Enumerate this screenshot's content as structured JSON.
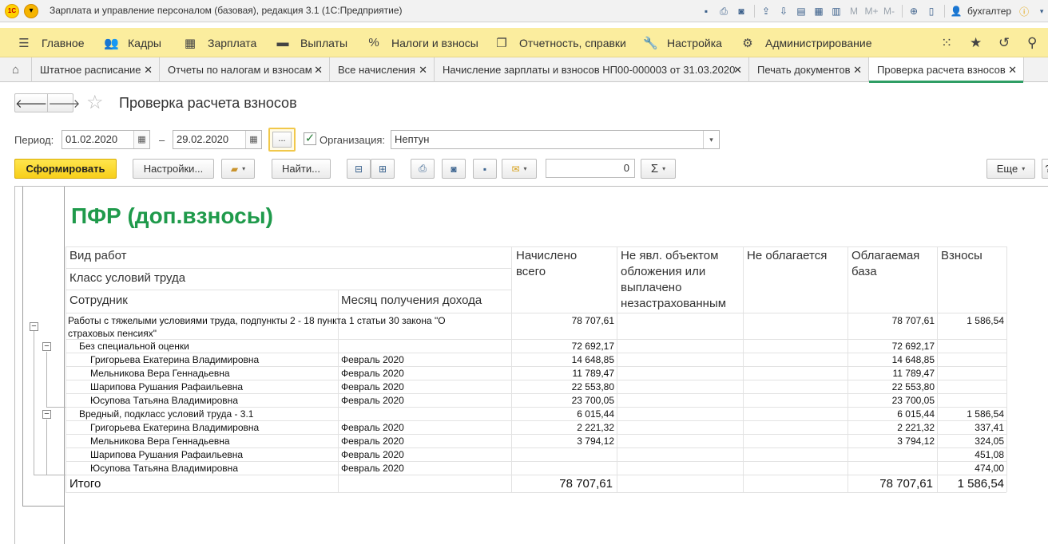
{
  "window": {
    "logo_text": "1С",
    "title": "Зарплата и управление персоналом (базовая), редакция 3.1  (1С:Предприятие)",
    "user": "бухгалтер",
    "zoom_icons": [
      "M",
      "M+",
      "M-"
    ]
  },
  "main_menu": [
    {
      "label": "Главное",
      "icon": "hamburger-icon"
    },
    {
      "label": "Кадры",
      "icon": "people-icon"
    },
    {
      "label": "Зарплата",
      "icon": "calculator-icon"
    },
    {
      "label": "Выплаты",
      "icon": "wallet-icon"
    },
    {
      "label": "Налоги и взносы",
      "icon": "percent-icon"
    },
    {
      "label": "Отчетность, справки",
      "icon": "documents-icon"
    },
    {
      "label": "Настройка",
      "icon": "wrench-icon"
    },
    {
      "label": "Администрирование",
      "icon": "gear-icon"
    }
  ],
  "tabs": [
    {
      "label": "Штатное расписание"
    },
    {
      "label": "Отчеты по налогам и взносам"
    },
    {
      "label": "Все начисления"
    },
    {
      "label": "Начисление зарплаты и взносов НП00-000003 от 31.03.2020"
    },
    {
      "label": "Печать документов"
    },
    {
      "label": "Проверка расчета взносов",
      "active": true
    }
  ],
  "form": {
    "title": "Проверка расчета взносов",
    "period_label": "Период:",
    "date_from": "01.02.2020",
    "dash": "–",
    "date_to": "29.02.2020",
    "dots": "...",
    "org_label": "Организация:",
    "org_value": "Нептун",
    "org_checked": true
  },
  "toolbar": {
    "generate": "Сформировать",
    "settings": "Настройки...",
    "find": "Найти...",
    "sum_value": "0",
    "sum_symbol": "Σ",
    "more": "Еще"
  },
  "report": {
    "title": "ПФР (доп.взносы)",
    "headers": {
      "work_type": "Вид работ",
      "conditions_class": "Класс условий труда",
      "employee": "Сотрудник",
      "income_month": "Месяц получения дохода",
      "accrued": "Начислено всего",
      "not_object": "Не явл. объектом обложения или выплачено незастрахованным",
      "not_taxed": "Не облагается",
      "tax_base": "Облагаемая база",
      "contributions": "Взносы"
    },
    "groups": [
      {
        "work_type": "Работы с тяжелыми условиями труда, подпункты 2 - 18 пункта 1 статьи 30 закона \"О страховых пенсиях\"",
        "accrued": "78 707,61",
        "tax_base": "78 707,61",
        "contributions": "1 586,54",
        "classes": [
          {
            "name": "Без специальной оценки",
            "accrued": "72 692,17",
            "tax_base": "72 692,17",
            "contributions": "",
            "rows": [
              {
                "employee": "Григорьева Екатерина Владимировна",
                "month": "Февраль 2020",
                "accrued": "14 648,85",
                "tax_base": "14 648,85",
                "contributions": ""
              },
              {
                "employee": "Мельникова Вера Геннадьевна",
                "month": "Февраль 2020",
                "accrued": "11 789,47",
                "tax_base": "11 789,47",
                "contributions": ""
              },
              {
                "employee": "Шарипова Рушания Рафаильевна",
                "month": "Февраль 2020",
                "accrued": "22 553,80",
                "tax_base": "22 553,80",
                "contributions": ""
              },
              {
                "employee": "Юсупова Татьяна Владимировна",
                "month": "Февраль 2020",
                "accrued": "23 700,05",
                "tax_base": "23 700,05",
                "contributions": ""
              }
            ]
          },
          {
            "name": "Вредный, подкласс условий труда - 3.1",
            "accrued": "6 015,44",
            "tax_base": "6 015,44",
            "contributions": "1 586,54",
            "rows": [
              {
                "employee": "Григорьева Екатерина Владимировна",
                "month": "Февраль 2020",
                "accrued": "2 221,32",
                "tax_base": "2 221,32",
                "contributions": "337,41"
              },
              {
                "employee": "Мельникова Вера Геннадьевна",
                "month": "Февраль 2020",
                "accrued": "3 794,12",
                "tax_base": "3 794,12",
                "contributions": "324,05"
              },
              {
                "employee": "Шарипова Рушания Рафаильевна",
                "month": "Февраль 2020",
                "accrued": "",
                "tax_base": "",
                "contributions": "451,08"
              },
              {
                "employee": "Юсупова Татьяна Владимировна",
                "month": "Февраль 2020",
                "accrued": "",
                "tax_base": "",
                "contributions": "474,00"
              }
            ]
          }
        ]
      }
    ],
    "total": {
      "label": "Итого",
      "accrued": "78 707,61",
      "tax_base": "78 707,61",
      "contributions": "1 586,54"
    }
  },
  "colors": {
    "menu_bg": "#fbed9e",
    "title_green": "#1f9a4b",
    "primary_button": "#f7cf1a",
    "active_tab_underline": "#2f9e64"
  }
}
